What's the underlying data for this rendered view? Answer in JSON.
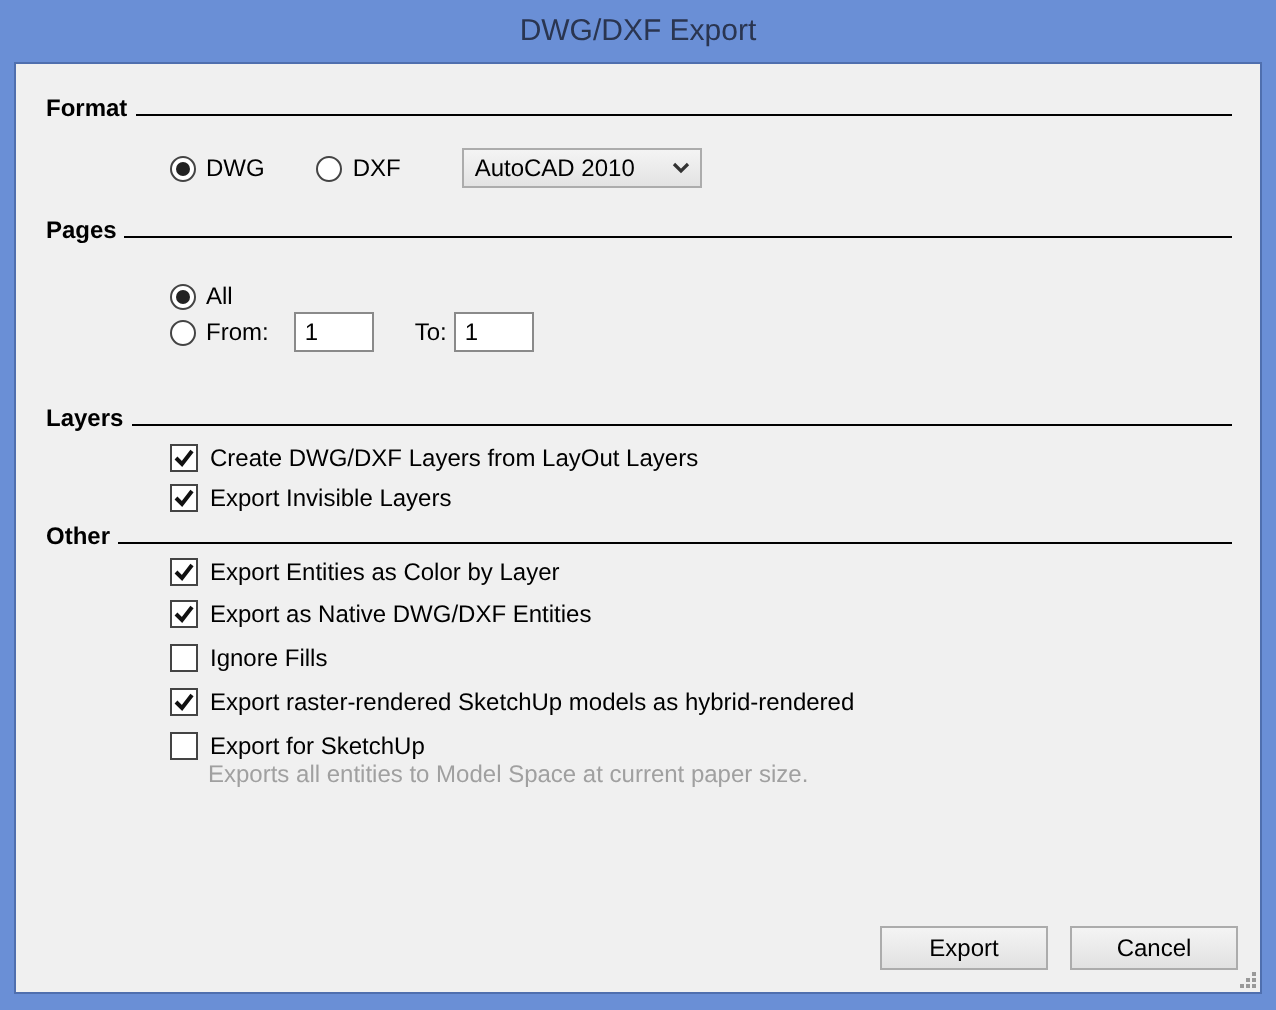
{
  "window": {
    "title": "DWG/DXF Export"
  },
  "format": {
    "heading": "Format",
    "options": [
      {
        "label": "DWG",
        "selected": true
      },
      {
        "label": "DXF",
        "selected": false
      }
    ],
    "version": "AutoCAD 2010"
  },
  "pages": {
    "heading": "Pages",
    "options": [
      {
        "label": "All",
        "selected": true
      },
      {
        "label": "From:",
        "selected": false
      }
    ],
    "from_value": "1",
    "to_label": "To:",
    "to_value": "1"
  },
  "layers": {
    "heading": "Layers",
    "options": [
      {
        "label": "Create DWG/DXF Layers from LayOut Layers",
        "checked": true
      },
      {
        "label": "Export Invisible Layers",
        "checked": true
      }
    ]
  },
  "other": {
    "heading": "Other",
    "options": [
      {
        "label": "Export Entities as Color by Layer",
        "checked": true
      },
      {
        "label": "Export as Native DWG/DXF Entities",
        "checked": true
      },
      {
        "label": "Ignore Fills",
        "checked": false
      },
      {
        "label": "Export raster-rendered SketchUp models as hybrid-rendered",
        "checked": true
      },
      {
        "label": "Export for SketchUp",
        "checked": false,
        "note": "Exports all entities to Model Space at current paper size."
      }
    ]
  },
  "buttons": [
    "Export",
    "Cancel"
  ]
}
